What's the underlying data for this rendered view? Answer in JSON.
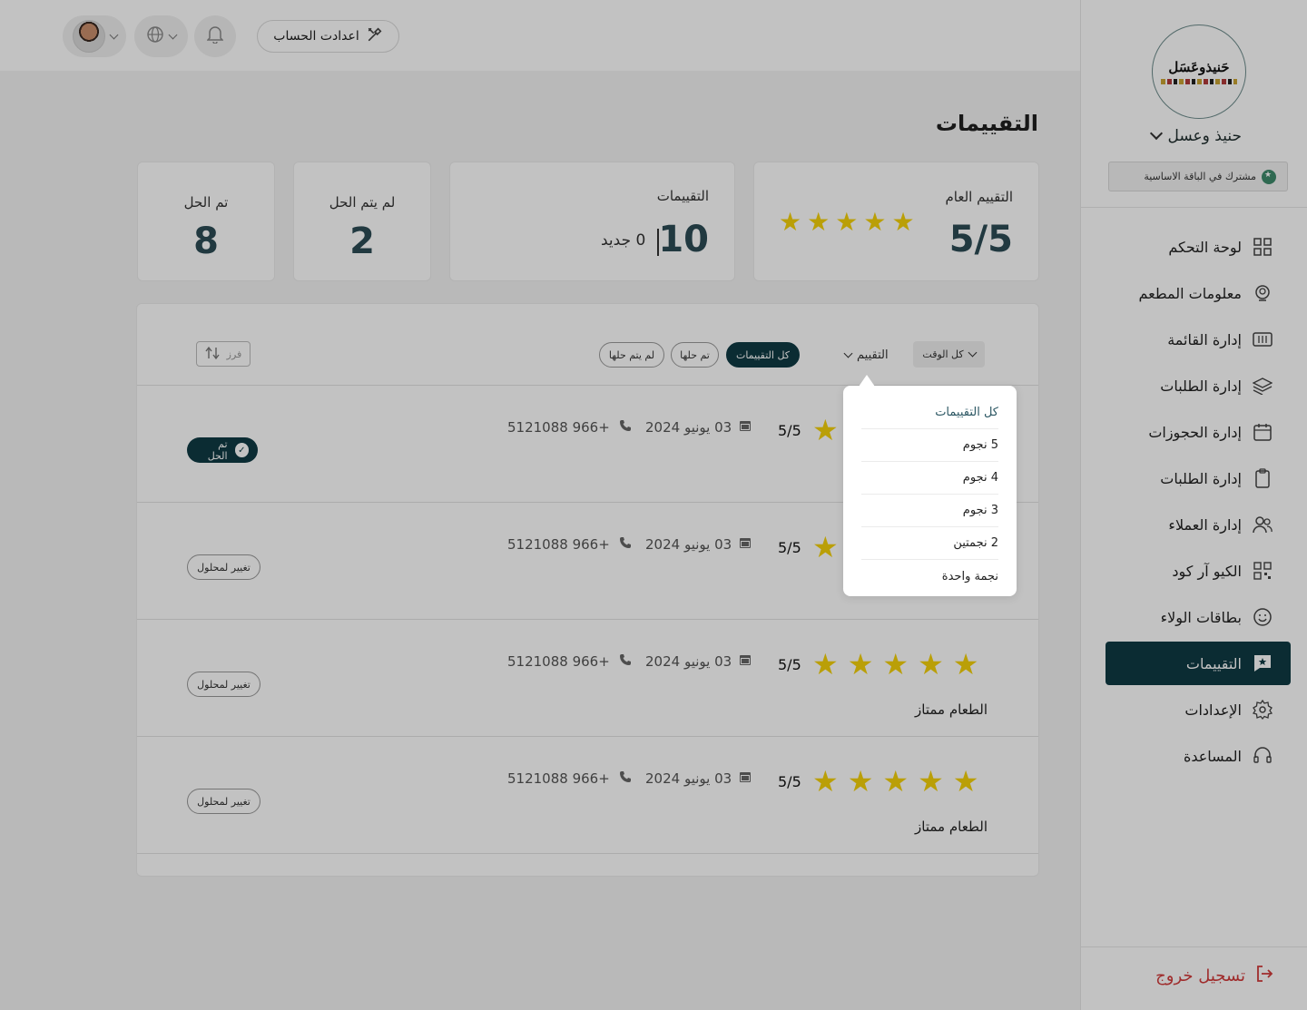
{
  "sidebar": {
    "logo_text": "حَنيذوعَسَل",
    "brand_name": "حنيذ وعسل",
    "plan": "مشترك في الباقة الاساسية",
    "items": [
      {
        "label": "لوحة التحكم",
        "icon": "grid-icon",
        "active": false
      },
      {
        "label": "معلومات المطعم",
        "icon": "chef-icon",
        "active": false
      },
      {
        "label": "إدارة القائمة",
        "icon": "menu-icon",
        "active": false
      },
      {
        "label": "إدارة الطلبات",
        "icon": "layers-icon",
        "active": false
      },
      {
        "label": "إدارة الحجوزات",
        "icon": "calendar-icon",
        "active": false
      },
      {
        "label": "إدارة الطلبات",
        "icon": "clipboard-icon",
        "active": false
      },
      {
        "label": "إدارة العملاء",
        "icon": "users-icon",
        "active": false
      },
      {
        "label": "الكيو آر كود",
        "icon": "qr-icon",
        "active": false
      },
      {
        "label": "بطاقات الولاء",
        "icon": "smile-icon",
        "active": false
      },
      {
        "label": "التقييمات",
        "icon": "star-flag-icon",
        "active": true
      },
      {
        "label": "الإعدادات",
        "icon": "gear-icon",
        "active": false
      },
      {
        "label": "المساعدة",
        "icon": "headset-icon",
        "active": false
      }
    ],
    "logout": "تسجيل خروج"
  },
  "header": {
    "account_settings": "اعدادت الحساب"
  },
  "page": {
    "title": "التقييمات"
  },
  "stats": {
    "overall_label": "التقييم العام",
    "overall_value": "5/5",
    "overall_stars": 5,
    "reviews_label": "التقييمات",
    "reviews_count": "10",
    "reviews_new": "0 جديد",
    "unresolved_label": "لم يتم الحل",
    "unresolved_value": "2",
    "resolved_label": "تم الحل",
    "resolved_value": "8"
  },
  "filters": {
    "time": "كل الوقت",
    "rating": "التقييم",
    "chip_all": "كل التقييمات",
    "chip_resolved": "تم حلها",
    "chip_unresolved": "لم يتم حلها",
    "sort": "فرز"
  },
  "reviews": [
    {
      "score": "5/5",
      "stars": 5,
      "date": "03 يونيو 2024",
      "phone": "+966 5121088",
      "comment": "",
      "status": "تم الحل",
      "resolved": true
    },
    {
      "score": "5/5",
      "stars": 5,
      "date": "03 يونيو 2024",
      "phone": "+966 5121088",
      "comment": "",
      "status": "تغيير لمحلول",
      "resolved": false
    },
    {
      "score": "5/5",
      "stars": 5,
      "date": "03 يونيو 2024",
      "phone": "+966 5121088",
      "comment": "الطعام ممتاز",
      "status": "تغيير لمحلول",
      "resolved": false
    },
    {
      "score": "5/5",
      "stars": 5,
      "date": "03 يونيو 2024",
      "phone": "+966 5121088",
      "comment": "الطعام ممتاز",
      "status": "تغيير لمحلول",
      "resolved": false
    }
  ],
  "rating_dropdown": {
    "options": [
      "كل التقييمات",
      "5 نجوم",
      "4 نجوم",
      "3 نجوم",
      "2 نجمتين",
      "نجمة واحدة"
    ],
    "selected": "كل التقييمات"
  },
  "colors": {
    "primary": "#0f3a44",
    "star": "#f5d20a",
    "logout": "#d23a3a"
  }
}
